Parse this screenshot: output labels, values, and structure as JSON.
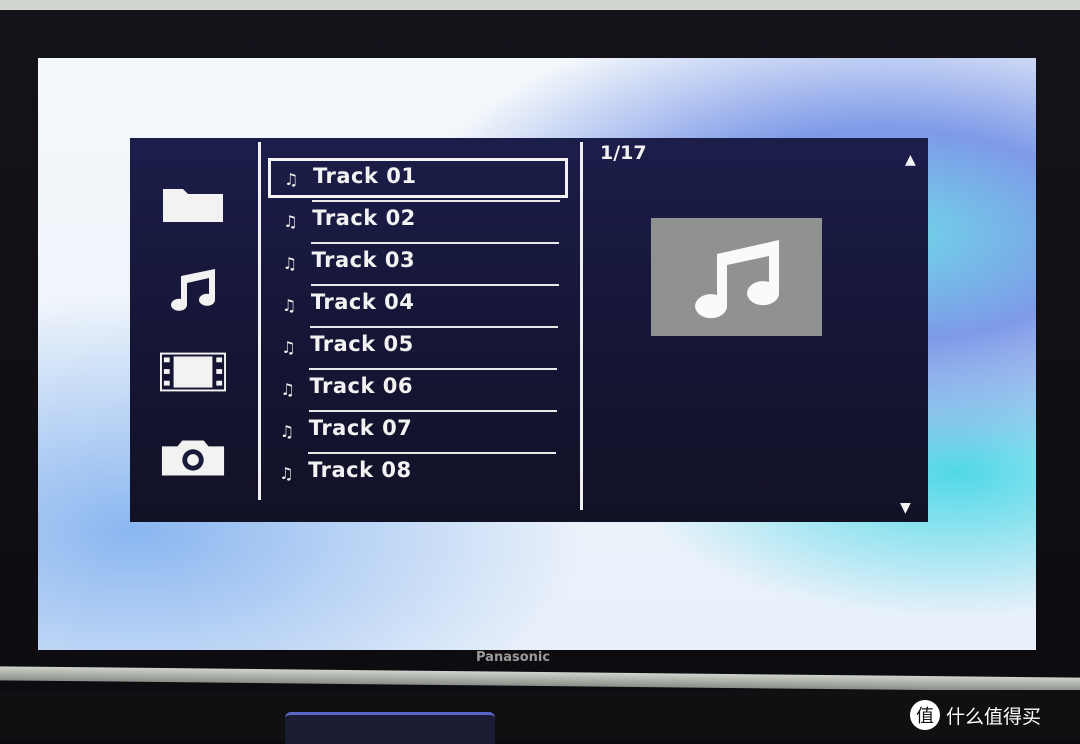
{
  "device": {
    "brand": "Panasonic",
    "watermark": "什么值得买",
    "watermark_glyph": "值"
  },
  "sidebar": {
    "items": [
      {
        "icon": "folder-icon"
      },
      {
        "icon": "music-icon"
      },
      {
        "icon": "film-icon"
      },
      {
        "icon": "camera-icon"
      }
    ]
  },
  "list": {
    "note_glyph": "♫",
    "items": [
      {
        "label": "Track 01",
        "selected": true
      },
      {
        "label": "Track 02"
      },
      {
        "label": "Track 03"
      },
      {
        "label": "Track 04"
      },
      {
        "label": "Track 05"
      },
      {
        "label": "Track 06"
      },
      {
        "label": "Track 07"
      },
      {
        "label": "Track 08"
      }
    ]
  },
  "preview": {
    "counter": "1/17",
    "up_arrow": "▲",
    "down_arrow": "▼",
    "art_icon": "music-note-icon"
  },
  "colors": {
    "panel": "#1c1e4a",
    "text": "#f2f2f2",
    "art_bg": "#8f9291"
  }
}
